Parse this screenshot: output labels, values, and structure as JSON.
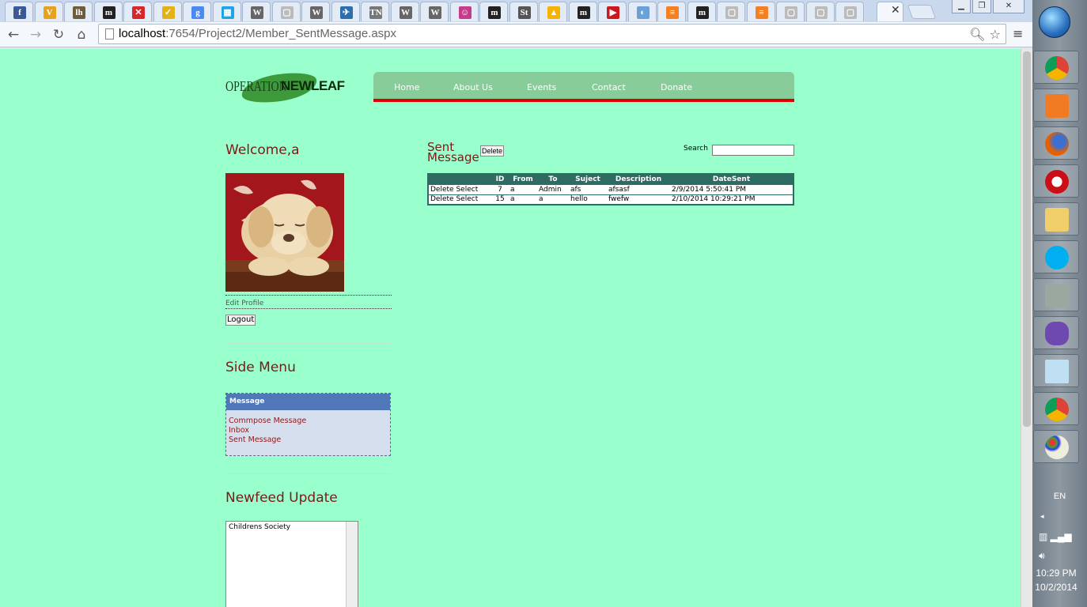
{
  "browser": {
    "url_host": "localhost",
    "url_path": ":7654/Project2/Member_SentMessage.aspx",
    "tabs": [
      {
        "glyph": "f",
        "color": "#3b5998"
      },
      {
        "glyph": "V",
        "color": "#e8a21a"
      },
      {
        "glyph": "lh",
        "color": "#6e5b3a"
      },
      {
        "glyph": "m",
        "color": "#222222"
      },
      {
        "glyph": "✕",
        "color": "#d7262c"
      },
      {
        "glyph": "✓",
        "color": "#e3b118"
      },
      {
        "glyph": "g",
        "color": "#4a8af4"
      },
      {
        "glyph": "▦",
        "color": "#1fa3e8"
      },
      {
        "glyph": "W",
        "color": "#666666"
      },
      {
        "glyph": "▢",
        "color": "#bbbbbb"
      },
      {
        "glyph": "W",
        "color": "#666666"
      },
      {
        "glyph": "✈",
        "color": "#2c6fb0"
      },
      {
        "glyph": "TN",
        "color": "#777777"
      },
      {
        "glyph": "W",
        "color": "#666666"
      },
      {
        "glyph": "W",
        "color": "#666666"
      },
      {
        "glyph": "☺",
        "color": "#c83a8a"
      },
      {
        "glyph": "m",
        "color": "#222222"
      },
      {
        "glyph": "St",
        "color": "#555555"
      },
      {
        "glyph": "▲",
        "color": "#f4b400"
      },
      {
        "glyph": "m",
        "color": "#222222"
      },
      {
        "glyph": "▶",
        "color": "#cc181e"
      },
      {
        "glyph": "◐",
        "color": "#6aa0d8"
      },
      {
        "glyph": "≡",
        "color": "#f48024"
      },
      {
        "glyph": "m",
        "color": "#222222"
      },
      {
        "glyph": "▢",
        "color": "#bbbbbb"
      },
      {
        "glyph": "≡",
        "color": "#f48024"
      },
      {
        "glyph": "▢",
        "color": "#bbbbbb"
      },
      {
        "glyph": "▢",
        "color": "#bbbbbb"
      },
      {
        "glyph": "▢",
        "color": "#bbbbbb"
      }
    ]
  },
  "site": {
    "logo_part1": "OPERATION",
    "logo_part2": "NEWLEAF",
    "nav": [
      "Home",
      "About Us",
      "Events",
      "Contact",
      "Donate"
    ]
  },
  "sidebar": {
    "welcome": "Welcome,a",
    "edit_profile": "Edit Profile",
    "logout": "Logout",
    "side_menu_title": "Side Menu",
    "menu_header": "Message",
    "menu_items": [
      "Commpose Message",
      "Inbox",
      "Sent Message"
    ],
    "newsfeed_title": "Newfeed Update",
    "newsfeed_text": "Childrens Society"
  },
  "main": {
    "title_line1": "Sent",
    "title_line2": "Message",
    "delete_button": "Delete",
    "search_label": "Search",
    "search_value": "",
    "columns": [
      "",
      "ID",
      "From",
      "To",
      "Suject",
      "Description",
      "DateSent"
    ],
    "row_actions": [
      "Delete",
      "Select"
    ],
    "rows": [
      {
        "id": "7",
        "from": "a",
        "to": "Admin",
        "subject": "afs",
        "description": "afsasf",
        "date": "2/9/2014 5:50:41 PM"
      },
      {
        "id": "15",
        "from": "a",
        "to": "a",
        "subject": "hello",
        "description": "fwefw",
        "date": "2/10/2014 10:29:21 PM"
      }
    ]
  },
  "taskbar": {
    "lang": "EN",
    "time": "10:29 PM",
    "date": "10/2/2014"
  }
}
